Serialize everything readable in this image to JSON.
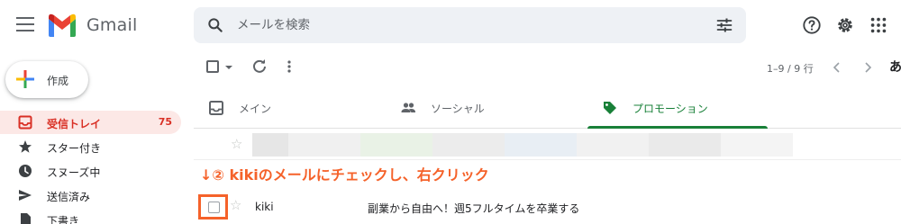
{
  "header": {
    "brand": "Gmail",
    "search_placeholder": "メールを検索"
  },
  "compose": {
    "label": "作成"
  },
  "sidebar": {
    "items": [
      {
        "label": "受信トレイ",
        "count": "75",
        "icon": "inbox-icon",
        "active": true
      },
      {
        "label": "スター付き",
        "icon": "star-icon"
      },
      {
        "label": "スヌーズ中",
        "icon": "clock-icon"
      },
      {
        "label": "送信済み",
        "icon": "send-icon"
      },
      {
        "label": "下書き",
        "icon": "draft-icon"
      }
    ]
  },
  "toolbar": {
    "pagination": "1–9 / 9 行",
    "language": "あ"
  },
  "tabs": [
    {
      "label": "メイン",
      "icon": "inbox-icon"
    },
    {
      "label": "ソーシャル",
      "icon": "people-icon"
    },
    {
      "label": "プロモーション",
      "icon": "tag-icon",
      "active": true
    }
  ],
  "annotation": "↓② kikiのメールにチェックし、右クリック",
  "emails": [
    {
      "sender": "kiki",
      "subject": "副業から自由へ！週5フルタイムを卒業する"
    }
  ],
  "colors": {
    "active_nav_bg": "#fce8e6",
    "inbox_red": "#d93025",
    "promotions_green": "#188038",
    "annotation_orange": "#f5622a"
  }
}
